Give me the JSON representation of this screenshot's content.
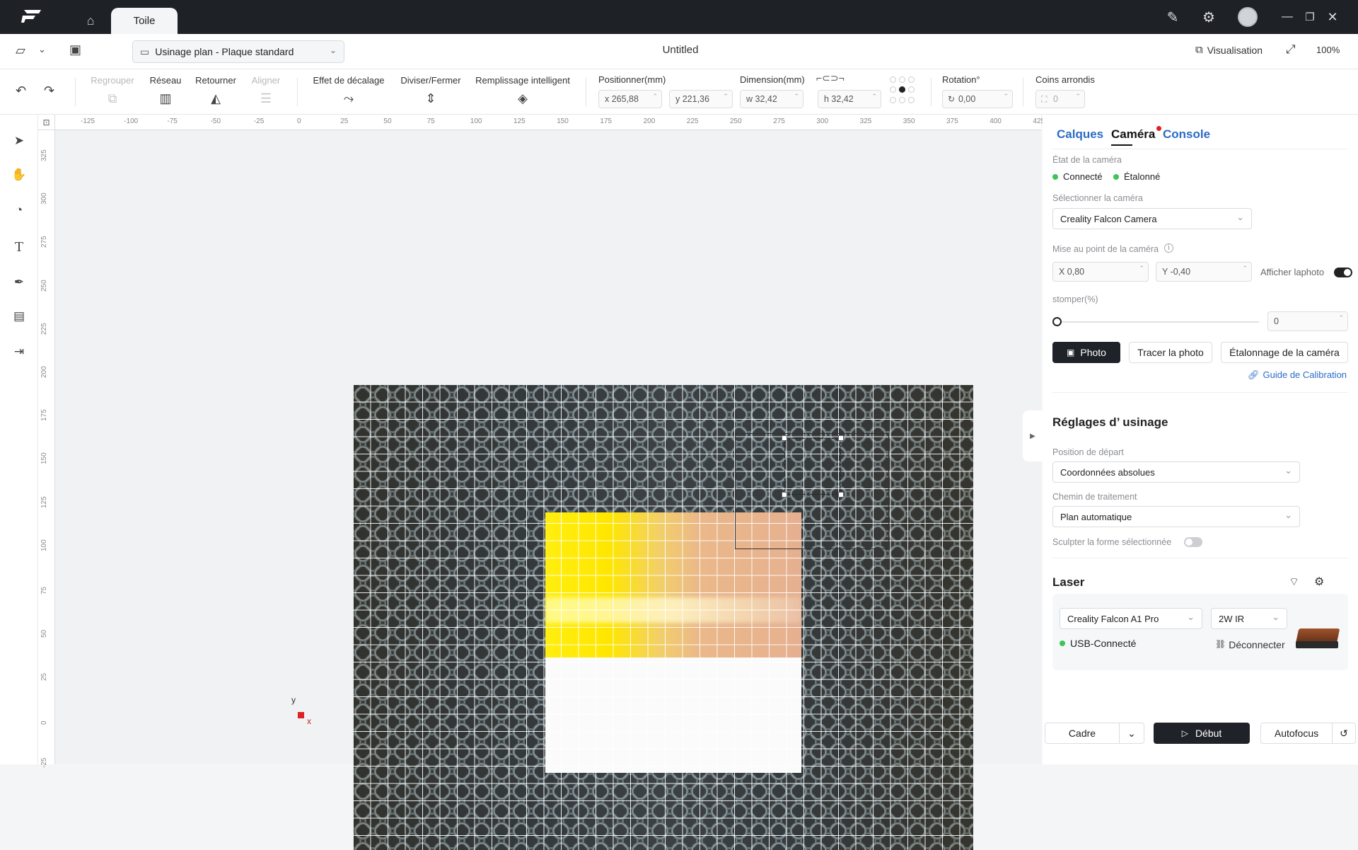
{
  "titlebar": {
    "tab": "Toile",
    "icons": [
      "home-icon",
      "notes-icon",
      "gear-icon",
      "avatar",
      "minimize-icon",
      "restore-icon",
      "close-icon"
    ]
  },
  "menubar": {
    "mode": "Usinage plan - Plaque standard",
    "title": "Untitled",
    "preview": "Visualisation",
    "zoom": "100%"
  },
  "toolbar": {
    "group": "Regrouper",
    "array": "Réseau",
    "flip": "Retourner",
    "align": "Aligner",
    "offset": "Effet de décalage",
    "divide": "Diviser/Fermer",
    "fill": "Remplissage intelligent",
    "position_label": "Positionner(mm)",
    "x": "x 265,88",
    "y": "y 221,36",
    "dimension_label": "Dimension(mm)",
    "w": "w 32,42",
    "h": "h 32,42",
    "rotation_label": "Rotation°",
    "rotation": "0,00",
    "corners_label": "Coins arrondis",
    "corners": "0"
  },
  "ruler": {
    "h": [
      "-125",
      "-100",
      "-75",
      "-50",
      "-25",
      "0",
      "25",
      "50",
      "75",
      "100",
      "125",
      "150",
      "175",
      "200",
      "225",
      "250",
      "275",
      "300",
      "325",
      "350",
      "375",
      "400",
      "425"
    ],
    "v": [
      "325",
      "300",
      "275",
      "250",
      "225",
      "200",
      "175",
      "150",
      "125",
      "100",
      "75",
      "50",
      "25",
      "0",
      "-25"
    ]
  },
  "axis": {
    "x": "x",
    "y": "y"
  },
  "sidebar": {
    "tabs": [
      "Calques",
      "Caméra",
      "Console"
    ],
    "camera_state_label": "État de la caméra",
    "connected": "Connecté",
    "calibrated": "Étalonné",
    "select_camera_label": "Sélectionner la caméra",
    "camera": "Creality Falcon Camera",
    "focus_label": "Mise au point de la caméra",
    "focus_x": "X 0,80",
    "focus_y": "Y -0,40",
    "show_photo": "Afficher laphoto",
    "blur_label": "stomper(%)",
    "blur_value": "0",
    "photo_btn": "Photo",
    "trace_btn": "Tracer la photo",
    "calib_btn": "Étalonnage de la caméra",
    "guide": "Guide de Calibration",
    "machining_title": "Réglages d’ usinage",
    "start_label": "Position de départ",
    "start_value": "Coordonnées absolues",
    "path_label": "Chemin de traitement",
    "path_value": "Plan automatique",
    "sculpt_label": "Sculpter la forme sélectionnée",
    "laser_title": "Laser",
    "machine": "Creality Falcon A1 Pro",
    "module": "2W IR",
    "usb": "USB-Connecté",
    "disconnect": "Déconnecter"
  },
  "bottom": {
    "frame": "Cadre",
    "start": "Début",
    "autofocus": "Autofocus"
  },
  "colors": {
    "accent": "#2b6bc5",
    "status_green": "#3fc45a",
    "camera_badge": "#e02020"
  }
}
